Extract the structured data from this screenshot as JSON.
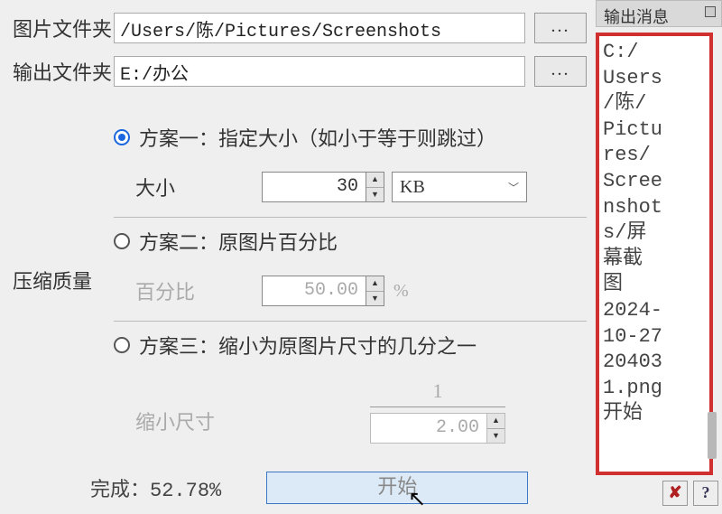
{
  "folders": {
    "image_label": "图片文件夹",
    "image_path": "/Users/陈/Pictures/Screenshots",
    "output_label": "输出文件夹",
    "output_path": "E:/办公",
    "browse": "..."
  },
  "quality": {
    "section_label": "压缩质量",
    "opt1": {
      "label": "方案一：指定大小（如小于等于则跳过）",
      "size_label": "大小",
      "size_value": "30",
      "unit": "KB"
    },
    "opt2": {
      "label": "方案二：原图片百分比",
      "pct_label": "百分比",
      "pct_value": "50.00",
      "pct_sym": "%"
    },
    "opt3": {
      "label": "方案三：缩小为原图片尺寸的几分之一",
      "shrink_label": "缩小尺寸",
      "numerator": "1",
      "denominator": "2.00"
    }
  },
  "status": {
    "done_prefix": "完成：",
    "done_pct": "52.78%",
    "start_label": "开始"
  },
  "right": {
    "title": "输出消息",
    "log": "C:/\nUsers\n/陈/\nPictu\nres/\nScree\nnshot\ns/屏\n幕截\n图\n2024-\n10-27\n20403\n1.png\n开始"
  },
  "icons": {
    "close": "✘",
    "help": "?"
  }
}
